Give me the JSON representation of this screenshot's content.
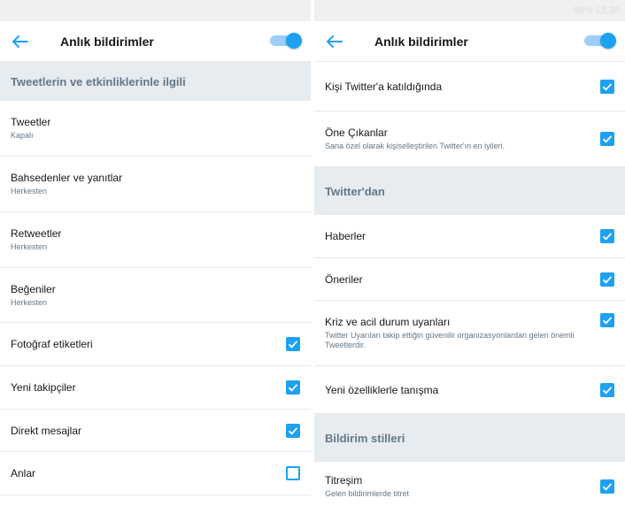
{
  "left": {
    "status": "",
    "title": "Anlık bildirimler",
    "section": "Tweetlerin ve etkinliklerinle ilgili",
    "items": [
      {
        "title": "Tweetler",
        "sub": "Kapalı"
      },
      {
        "title": "Bahsedenler ve yanıtlar",
        "sub": "Herkesten"
      },
      {
        "title": "Retweetler",
        "sub": "Herkesten"
      },
      {
        "title": "Beğeniler",
        "sub": "Herkesten"
      },
      {
        "title": "Fotoğraf etiketleri",
        "checked": true
      },
      {
        "title": "Yeni takipçiler",
        "checked": true
      },
      {
        "title": "Direkt mesajlar",
        "checked": true
      },
      {
        "title": "Anlar",
        "checked": false
      }
    ]
  },
  "right": {
    "status": "98% 13:36",
    "title": "Anlık bildirimler",
    "items_top": [
      {
        "title": "Kişi Twitter'a katıldığında",
        "checked": true
      },
      {
        "title": "Öne Çıkanlar",
        "sub": "Sana özel olarak kişiselleştirilen Twitter'ın en iyileri.",
        "checked": true
      }
    ],
    "section_twitter": "Twitter'dan",
    "items_twitter": [
      {
        "title": "Haberler",
        "checked": true
      },
      {
        "title": "Öneriler",
        "checked": true
      },
      {
        "title": "Kriz ve acil durum uyanları",
        "sub": "Twitter Uyarıları takip ettiğin güvenilir organizasyonlardan gelen önemli Tweetlerdir.",
        "checked": true
      },
      {
        "title": "Yeni özelliklerle tanışma",
        "checked": true
      }
    ],
    "section_styles": "Bildirim stilleri",
    "items_styles": [
      {
        "title": "Titreşim",
        "sub": "Gelen bildirimlerde titret",
        "checked": true
      }
    ]
  },
  "colors": {
    "accent": "#1da1f2",
    "section_bg": "#e6ecf0",
    "section_text": "#657786",
    "divider": "#e6e8ea"
  }
}
